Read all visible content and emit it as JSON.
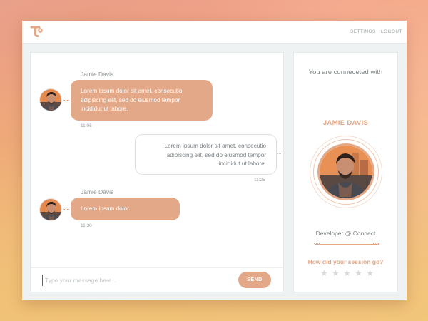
{
  "header": {
    "settings_label": "SETTINGS",
    "logout_label": "LOGOUT"
  },
  "chat": {
    "messages": [
      {
        "sender": "Jamie Davis",
        "direction": "incoming",
        "lines": [
          "Lorem ipsum dolor sit amet, consecutio",
          "adipiscing elit, sed do eiusmod tempor",
          "incididut ut labore."
        ],
        "time": "11:06"
      },
      {
        "sender": "",
        "direction": "outgoing",
        "lines": [
          "Lorem ipsum dolor sit amet, consecutio",
          "adipiscing elit, sed do eiusmod tempor",
          "incididut ut labore."
        ],
        "time": "11:25"
      },
      {
        "sender": "Jamie Davis",
        "direction": "incoming",
        "lines": [
          "Lorem ipsum dolor."
        ],
        "time": "11:30"
      }
    ],
    "input_placeholder": "Type your message here...",
    "send_label": "SEND"
  },
  "profile": {
    "connected_text": "You are conneceted with",
    "name": "JAMIE DAVIS",
    "role": "Developer @  Connect",
    "session_question": "How did your session go?",
    "rating": 0,
    "rating_max": 5
  },
  "colors": {
    "accent": "#e3a887",
    "panel": "#ffffff",
    "window_bg": "#eef2f2"
  }
}
